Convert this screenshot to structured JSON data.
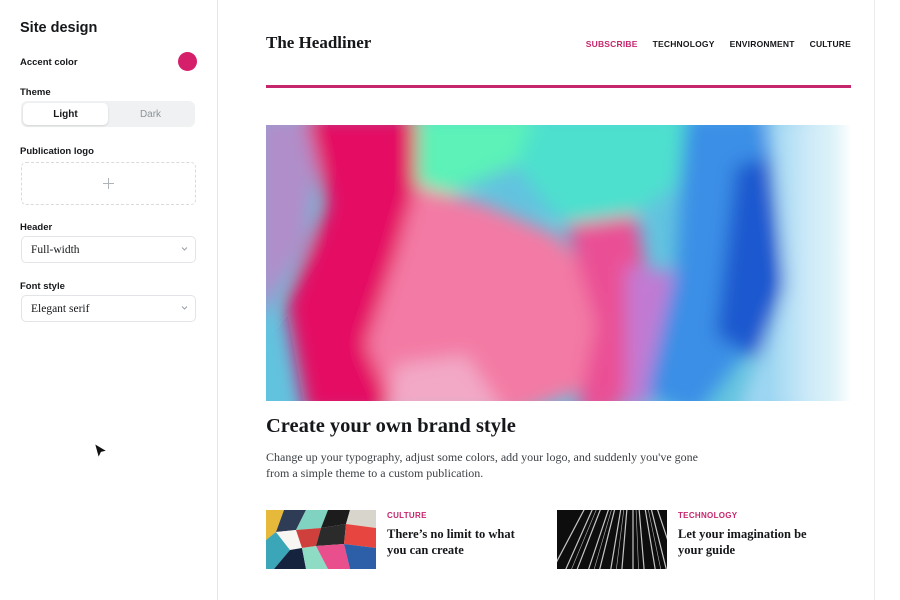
{
  "theme": {
    "accent": "#c5276c",
    "swatch": "#d61f6a"
  },
  "sidebar": {
    "title": "Site design",
    "accent_color": {
      "label": "Accent color"
    },
    "theme": {
      "label": "Theme",
      "options": [
        "Light",
        "Dark"
      ],
      "selected": "Light"
    },
    "publication_logo": {
      "label": "Publication logo",
      "icon": "plus-icon"
    },
    "header": {
      "label": "Header",
      "value": "Full-width",
      "icon": "chevron-down-icon"
    },
    "font_style": {
      "label": "Font style",
      "value": "Elegant serif",
      "icon": "chevron-down-icon"
    }
  },
  "preview": {
    "brand": "The Headliner",
    "nav": [
      "SUBSCRIBE",
      "TECHNOLOGY",
      "ENVIRONMENT",
      "CULTURE"
    ],
    "hero_title": "Create your own brand style",
    "hero_excerpt": "Change up your typography, adjust some colors, add your logo, and suddenly you've gone from a simple theme to a custom publication.",
    "cards": [
      {
        "tag": "CULTURE",
        "title": "There’s no limit to what you can create"
      },
      {
        "tag": "TECHNOLOGY",
        "title": "Let your imagination be your guide"
      }
    ]
  }
}
